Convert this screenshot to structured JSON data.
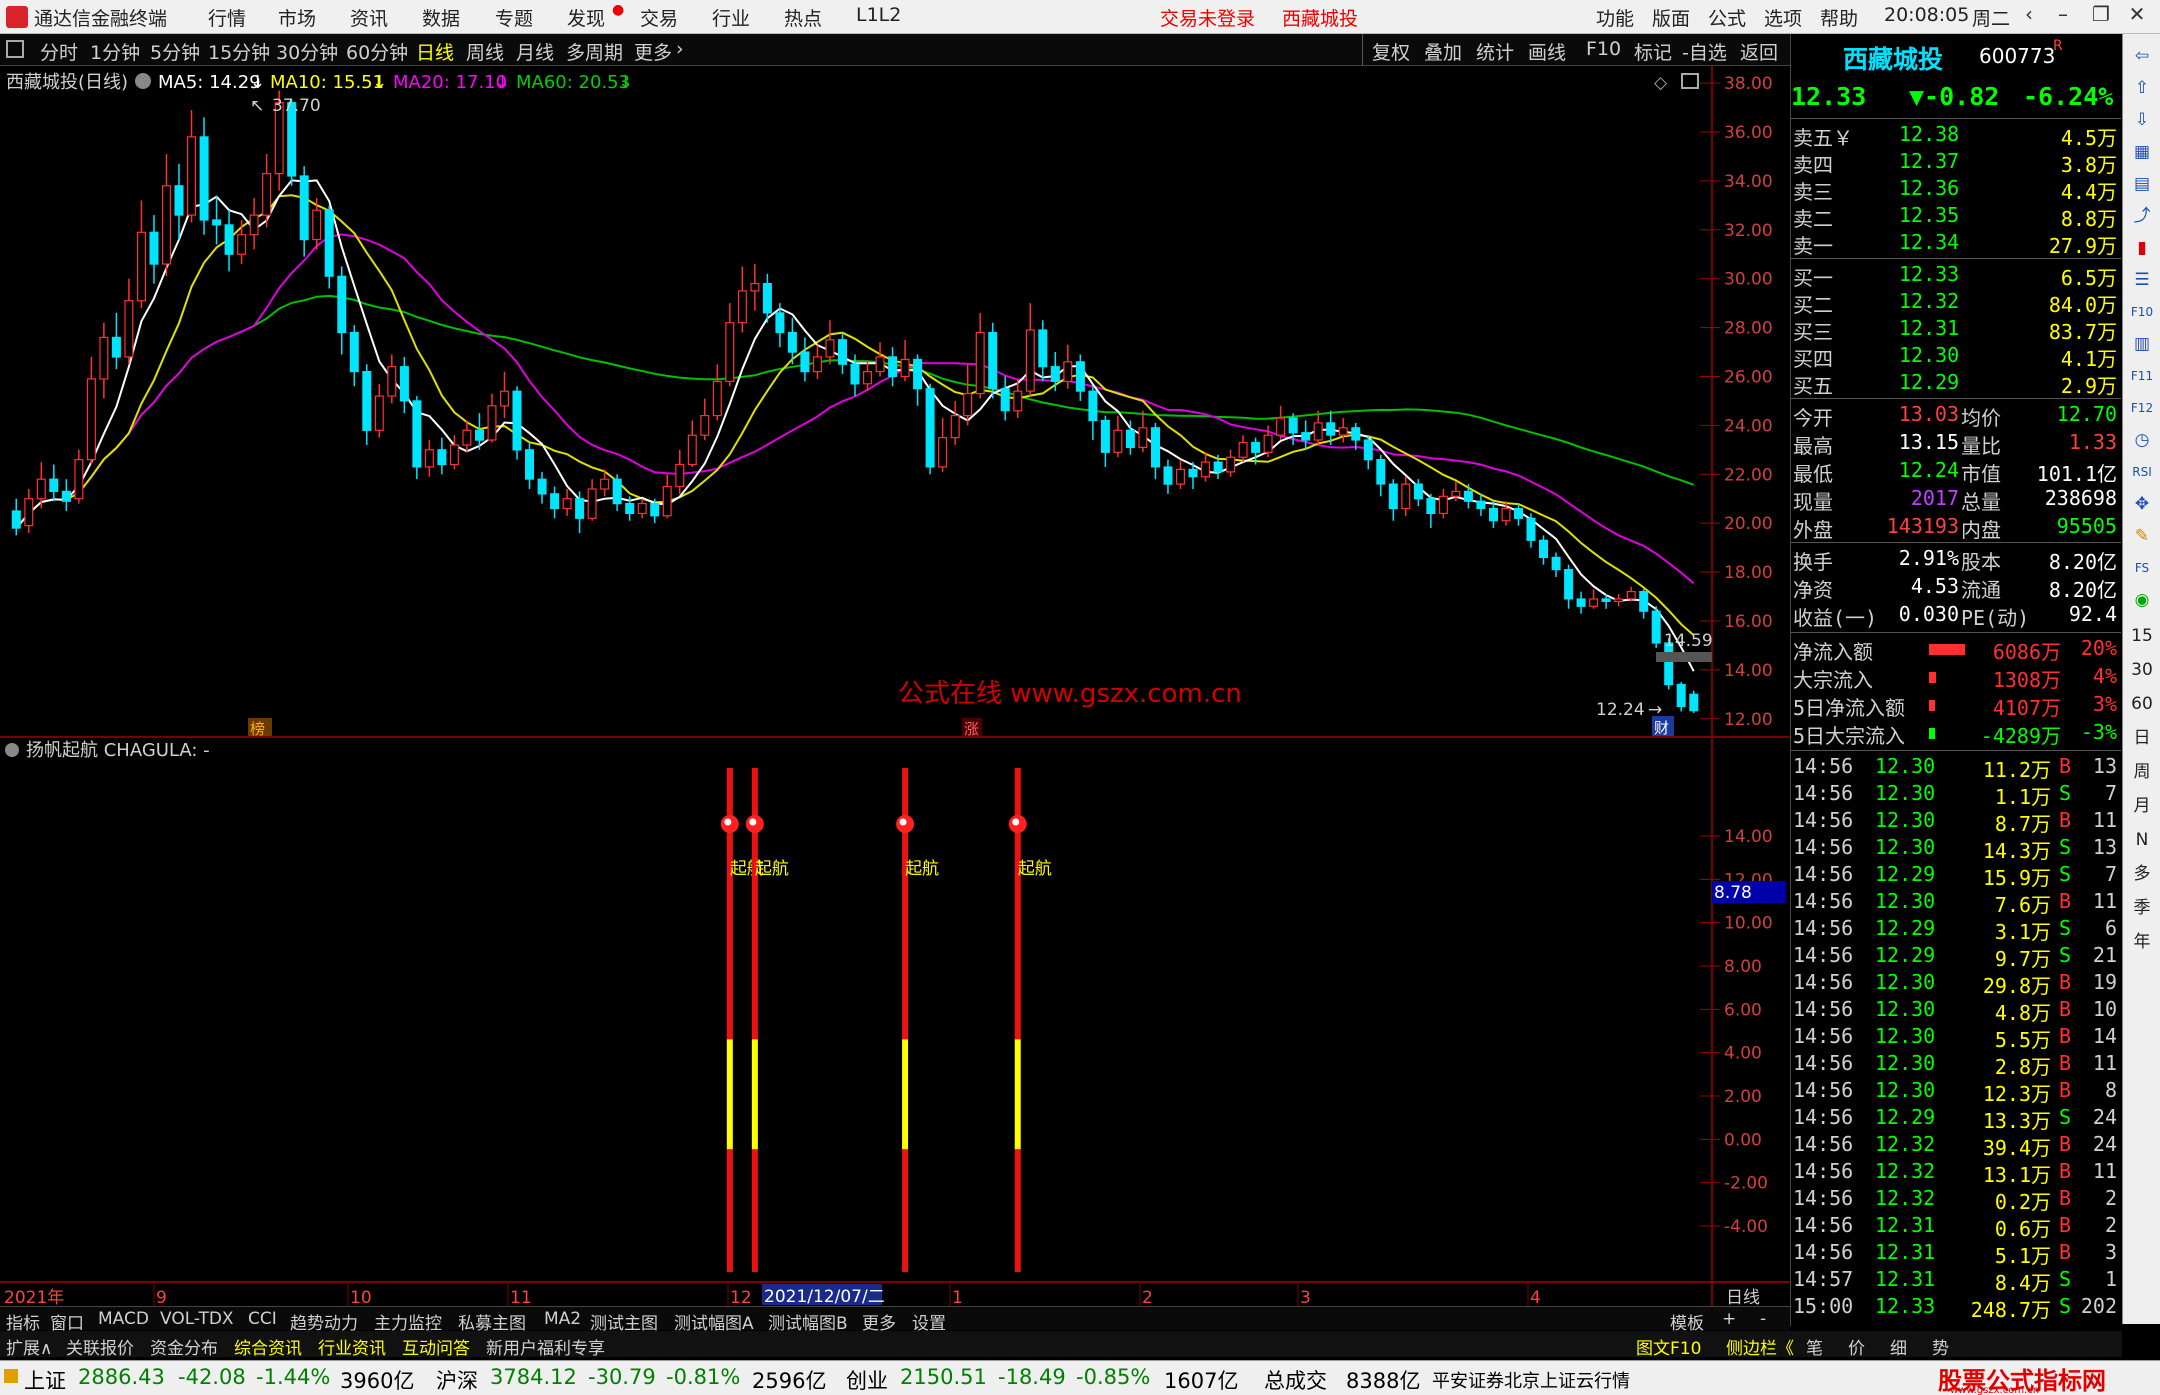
{
  "title_bar": {
    "app_title": "通达信金融终端",
    "menu": [
      "行情",
      "市场",
      "资讯",
      "数据",
      "专题",
      "发现",
      "交易",
      "行业",
      "热点",
      "L1L2"
    ],
    "trade_status": "交易未登录",
    "stock": "西藏城投",
    "right_menu": [
      "功能",
      "版面",
      "公式",
      "选项",
      "帮助"
    ],
    "time": "20:08:05",
    "weekday": "周二"
  },
  "period_bar": {
    "tabs": [
      "分时",
      "1分钟",
      "5分钟",
      "15分钟",
      "30分钟",
      "60分钟",
      "日线",
      "周线",
      "月线",
      "多周期",
      "更多"
    ],
    "active": "日线",
    "tools": [
      "复权",
      "叠加",
      "统计",
      "画线",
      "F10",
      "标记",
      "-自选",
      "返回"
    ]
  },
  "main_chart": {
    "header_stock": "西藏城投(日线)",
    "ma_labels": [
      {
        "text": "MA5: 14.29",
        "color": "#ffffff"
      },
      {
        "text": "MA10: 15.51",
        "color": "#ffff00"
      },
      {
        "text": "MA20: 17.10",
        "color": "#ff00ff"
      },
      {
        "text": "MA60: 20.53",
        "color": "#00d000"
      }
    ],
    "high_label": "37.70",
    "low_label": "12.24",
    "last_price_tag": "14.59",
    "watermark": "公式在线  www.gszx.com.cn",
    "event_marks": [
      "榜",
      "涨",
      "财"
    ],
    "y_ticks": [
      "38.00",
      "36.00",
      "34.00",
      "32.00",
      "30.00",
      "28.00",
      "26.00",
      "24.00",
      "22.00",
      "20.00",
      "18.00",
      "16.00",
      "14.00",
      "12.00"
    ]
  },
  "indicator_chart": {
    "header": "扬帆起航  CHAGULA: -",
    "signal_label": "起航",
    "value_tag": "8.78",
    "y_ticks": [
      "14.00",
      "12.00",
      "10.00",
      "8.00",
      "6.00",
      "4.00",
      "2.00",
      "0.00",
      "-2.00",
      "-4.00"
    ]
  },
  "date_axis": {
    "labels": [
      "2021年",
      "9",
      "10",
      "11",
      "12",
      "2021/12/07/二",
      "1",
      "2",
      "3",
      "4"
    ],
    "period": "日线"
  },
  "bottom_tabs": [
    "指标",
    "窗口",
    "MACD",
    "VOL-TDX",
    "CCI",
    "趋势动力",
    "主力监控",
    "私募主图",
    "MA2",
    "测试主图",
    "测试幅图A",
    "测试幅图B",
    "更多",
    "设置"
  ],
  "bottom_right": [
    "模板",
    "+",
    "-"
  ],
  "sub_tabs": [
    {
      "text": "扩展∧",
      "color": "#d0d0d0"
    },
    {
      "text": "关联报价",
      "color": "#d0d0d0"
    },
    {
      "text": "资金分布",
      "color": "#d0d0d0"
    },
    {
      "text": "综合资讯",
      "color": "#ffff00"
    },
    {
      "text": "行业资讯",
      "color": "#ffff00"
    },
    {
      "text": "互动问答",
      "color": "#ffff00"
    },
    {
      "text": "新用户福利专享",
      "color": "#d0d0d0"
    }
  ],
  "right_panel": {
    "name": "西藏城投",
    "code": "600773",
    "badge": "R",
    "price": "12.33",
    "change": "▼-0.82",
    "change_pct": "-6.24%",
    "asks": [
      {
        "label": "卖五￥",
        "price": "12.38",
        "vol": "4.5万"
      },
      {
        "label": "卖四",
        "price": "12.37",
        "vol": "3.8万"
      },
      {
        "label": "卖三",
        "price": "12.36",
        "vol": "4.4万"
      },
      {
        "label": "卖二",
        "price": "12.35",
        "vol": "8.8万"
      },
      {
        "label": "卖一",
        "price": "12.34",
        "vol": "27.9万"
      }
    ],
    "bids": [
      {
        "label": "买一",
        "price": "12.33",
        "vol": "6.5万"
      },
      {
        "label": "买二",
        "price": "12.32",
        "vol": "84.0万"
      },
      {
        "label": "买三",
        "price": "12.31",
        "vol": "83.7万"
      },
      {
        "label": "买四",
        "price": "12.30",
        "vol": "4.1万"
      },
      {
        "label": "买五",
        "price": "12.29",
        "vol": "2.9万"
      }
    ],
    "stats1": [
      [
        "今开",
        "13.03",
        "#ff4040",
        "均价",
        "12.70",
        "#00ff00"
      ],
      [
        "最高",
        "13.15",
        "#ffffff",
        "量比",
        "1.33",
        "#ff4040"
      ],
      [
        "最低",
        "12.24",
        "#00ff00",
        "市值",
        "101.1亿",
        "#ffffff"
      ],
      [
        "现量",
        "2017",
        "#c040ff",
        "总量",
        "238698",
        "#ffffff"
      ],
      [
        "外盘",
        "143193",
        "#ff4040",
        "内盘",
        "95505",
        "#00ff00"
      ]
    ],
    "stats2": [
      [
        "换手",
        "2.91%",
        "#ffffff",
        "股本",
        "8.20亿",
        "#ffffff"
      ],
      [
        "净资",
        "4.53",
        "#ffffff",
        "流通",
        "8.20亿",
        "#ffffff"
      ],
      [
        "收益(一)",
        "0.030",
        "#ffffff",
        "PE(动)",
        "92.4",
        "#ffffff"
      ]
    ],
    "flows": [
      {
        "label": "净流入额",
        "value": "6086万",
        "pct": "20%",
        "color": "#ff3030",
        "bar": 0.2
      },
      {
        "label": "大宗流入",
        "value": "1308万",
        "pct": "4%",
        "color": "#ff3030",
        "bar": 0.04
      },
      {
        "label": "5日净流入额",
        "value": "4107万",
        "pct": "3%",
        "color": "#ff3030",
        "bar": 0.03
      },
      {
        "label": "5日大宗流入",
        "value": "-4289万",
        "pct": "-3%",
        "color": "#00ff00",
        "bar": 0.03
      }
    ],
    "ticks": [
      [
        "14:56",
        "12.30",
        "11.2万",
        "B",
        "13"
      ],
      [
        "14:56",
        "12.30",
        "1.1万",
        "S",
        "7"
      ],
      [
        "14:56",
        "12.30",
        "8.7万",
        "B",
        "11"
      ],
      [
        "14:56",
        "12.30",
        "14.3万",
        "S",
        "13"
      ],
      [
        "14:56",
        "12.29",
        "15.9万",
        "S",
        "7"
      ],
      [
        "14:56",
        "12.30",
        "7.6万",
        "B",
        "11"
      ],
      [
        "14:56",
        "12.29",
        "3.1万",
        "S",
        "6"
      ],
      [
        "14:56",
        "12.29",
        "9.7万",
        "S",
        "21"
      ],
      [
        "14:56",
        "12.30",
        "29.8万",
        "B",
        "19"
      ],
      [
        "14:56",
        "12.30",
        "4.8万",
        "B",
        "10"
      ],
      [
        "14:56",
        "12.30",
        "5.5万",
        "B",
        "14"
      ],
      [
        "14:56",
        "12.30",
        "2.8万",
        "B",
        "11"
      ],
      [
        "14:56",
        "12.30",
        "12.3万",
        "B",
        "8"
      ],
      [
        "14:56",
        "12.29",
        "13.3万",
        "S",
        "24"
      ],
      [
        "14:56",
        "12.32",
        "39.4万",
        "B",
        "24"
      ],
      [
        "14:56",
        "12.32",
        "13.1万",
        "B",
        "11"
      ],
      [
        "14:56",
        "12.32",
        "0.2万",
        "B",
        "2"
      ],
      [
        "14:56",
        "12.31",
        "0.6万",
        "B",
        "2"
      ],
      [
        "14:56",
        "12.31",
        "5.1万",
        "B",
        "3"
      ],
      [
        "14:57",
        "12.31",
        "8.4万",
        "S",
        "1"
      ],
      [
        "15:00",
        "12.33",
        "248.7万",
        "S",
        "202"
      ]
    ],
    "bottom_tabs": [
      "图文F10",
      "侧边栏《",
      "笔",
      "价",
      "细",
      "势"
    ]
  },
  "toolstrip": {
    "icons": [
      "arrow-left-icon",
      "arrow-up-icon",
      "arrow-down-icon",
      "kline-icon",
      "grid-icon",
      "line-chart-icon",
      "candle-icon",
      "list-icon",
      "f10-icon",
      "f10b-icon",
      "f11-icon",
      "f12-icon",
      "clock-icon",
      "rsi-icon",
      "move-icon",
      "pen-icon",
      "fs-icon",
      "globe-icon"
    ],
    "labels": [
      "15",
      "30",
      "60",
      "日",
      "周",
      "月",
      "N",
      "多",
      "季",
      "年"
    ]
  },
  "status_bar": {
    "items": [
      {
        "name": "上证",
        "value": "2886.43",
        "change": "-42.08",
        "pct": "-1.44%",
        "amount": "3960亿"
      },
      {
        "name": "沪深",
        "value": "3784.12",
        "change": "-30.79",
        "pct": "-0.81%",
        "amount": "2596亿"
      },
      {
        "name": "创业",
        "value": "2150.51",
        "change": "-18.49",
        "pct": "-0.85%",
        "amount": "1607亿"
      }
    ],
    "total_label": "总成交",
    "total_value": "8388亿",
    "broker": "平安证券北京上证云行情",
    "site_logo": "股票公式指标网",
    "site_url": "www.gszx.com.cn"
  },
  "chart_data": {
    "type": "candlestick",
    "y_range": [
      11.5,
      38.7
    ],
    "candles": [
      [
        20.5,
        19.8,
        21.0,
        19.5
      ],
      [
        19.9,
        21.0,
        21.4,
        19.6
      ],
      [
        21.0,
        21.8,
        22.5,
        20.6
      ],
      [
        21.8,
        21.3,
        22.4,
        20.9
      ],
      [
        21.3,
        20.9,
        21.8,
        20.5
      ],
      [
        21.0,
        22.6,
        23.0,
        20.8
      ],
      [
        22.6,
        25.9,
        26.8,
        22.4
      ],
      [
        25.9,
        27.6,
        28.2,
        25.1
      ],
      [
        27.6,
        26.8,
        28.6,
        26.3
      ],
      [
        26.8,
        29.1,
        30.0,
        26.5
      ],
      [
        29.1,
        31.9,
        33.2,
        28.8
      ],
      [
        31.9,
        30.6,
        32.6,
        29.8
      ],
      [
        30.6,
        33.8,
        35.1,
        30.1
      ],
      [
        33.8,
        32.6,
        34.7,
        31.6
      ],
      [
        32.6,
        35.8,
        36.9,
        32.3
      ],
      [
        35.8,
        32.4,
        36.6,
        31.8
      ],
      [
        32.4,
        32.2,
        33.4,
        31.4
      ],
      [
        32.2,
        31.0,
        32.8,
        30.3
      ],
      [
        31.0,
        31.8,
        32.4,
        30.6
      ],
      [
        31.8,
        32.6,
        33.3,
        31.2
      ],
      [
        32.6,
        34.3,
        35.1,
        32.1
      ],
      [
        34.3,
        37.2,
        37.7,
        33.6
      ],
      [
        37.2,
        34.2,
        37.3,
        33.8
      ],
      [
        34.2,
        31.6,
        34.6,
        30.9
      ],
      [
        31.6,
        32.8,
        33.3,
        31.2
      ],
      [
        32.8,
        30.1,
        33.0,
        29.6
      ],
      [
        30.1,
        27.8,
        30.5,
        26.9
      ],
      [
        27.8,
        26.2,
        28.1,
        25.6
      ],
      [
        26.2,
        23.8,
        26.5,
        23.2
      ],
      [
        23.8,
        25.2,
        25.7,
        23.5
      ],
      [
        25.2,
        26.4,
        26.9,
        24.9
      ],
      [
        26.4,
        25.0,
        26.8,
        24.5
      ],
      [
        25.0,
        22.3,
        25.2,
        21.8
      ],
      [
        22.3,
        23.0,
        23.4,
        21.9
      ],
      [
        23.0,
        22.4,
        23.5,
        22.0
      ],
      [
        22.4,
        23.2,
        23.6,
        22.2
      ],
      [
        23.2,
        23.8,
        24.2,
        22.9
      ],
      [
        23.8,
        23.4,
        24.5,
        23.0
      ],
      [
        23.4,
        24.8,
        25.3,
        23.3
      ],
      [
        24.8,
        25.4,
        26.2,
        24.3
      ],
      [
        25.4,
        23.0,
        25.6,
        22.6
      ],
      [
        23.0,
        21.8,
        23.3,
        21.4
      ],
      [
        21.8,
        21.2,
        22.1,
        20.8
      ],
      [
        21.2,
        20.6,
        21.5,
        20.2
      ],
      [
        20.6,
        21.0,
        21.4,
        20.3
      ],
      [
        21.0,
        20.2,
        21.3,
        19.6
      ],
      [
        20.2,
        21.4,
        21.8,
        20.1
      ],
      [
        21.4,
        21.8,
        22.2,
        21.1
      ],
      [
        21.8,
        20.8,
        22.0,
        20.5
      ],
      [
        20.8,
        20.4,
        21.1,
        20.1
      ],
      [
        20.4,
        20.8,
        21.0,
        20.2
      ],
      [
        20.8,
        20.3,
        21.0,
        20.0
      ],
      [
        20.3,
        21.5,
        22.0,
        20.2
      ],
      [
        21.5,
        22.4,
        23.0,
        21.2
      ],
      [
        22.4,
        23.6,
        24.2,
        22.3
      ],
      [
        23.6,
        24.4,
        25.1,
        23.4
      ],
      [
        24.4,
        25.8,
        26.5,
        24.2
      ],
      [
        25.8,
        28.2,
        29.0,
        25.6
      ],
      [
        28.2,
        29.5,
        30.5,
        27.8
      ],
      [
        29.5,
        29.8,
        30.6,
        28.7
      ],
      [
        29.8,
        28.6,
        30.2,
        28.2
      ],
      [
        28.6,
        27.8,
        29.0,
        27.2
      ],
      [
        27.8,
        27.0,
        28.4,
        26.5
      ],
      [
        27.0,
        26.2,
        27.6,
        25.8
      ],
      [
        26.2,
        26.8,
        27.3,
        25.9
      ],
      [
        26.8,
        27.5,
        28.3,
        26.5
      ],
      [
        27.5,
        26.5,
        27.8,
        26.1
      ],
      [
        26.5,
        25.7,
        26.9,
        25.2
      ],
      [
        25.7,
        26.2,
        26.6,
        25.4
      ],
      [
        26.2,
        26.8,
        27.4,
        26.0
      ],
      [
        26.8,
        26.0,
        27.2,
        25.6
      ],
      [
        26.0,
        26.7,
        27.5,
        25.8
      ],
      [
        26.7,
        25.5,
        26.9,
        24.8
      ],
      [
        25.5,
        22.3,
        25.7,
        22.0
      ],
      [
        22.3,
        23.5,
        24.3,
        22.1
      ],
      [
        23.5,
        24.4,
        25.0,
        23.2
      ],
      [
        24.4,
        25.3,
        26.5,
        24.0
      ],
      [
        25.3,
        27.8,
        28.6,
        25.1
      ],
      [
        27.8,
        25.5,
        28.2,
        25.1
      ],
      [
        25.5,
        24.6,
        26.0,
        24.2
      ],
      [
        24.6,
        25.4,
        25.9,
        24.3
      ],
      [
        25.4,
        27.9,
        29.0,
        25.2
      ],
      [
        27.9,
        26.4,
        28.3,
        25.8
      ],
      [
        26.4,
        25.8,
        27.0,
        25.4
      ],
      [
        25.8,
        26.6,
        27.3,
        25.5
      ],
      [
        26.6,
        25.4,
        26.9,
        25.0
      ],
      [
        25.4,
        24.2,
        25.6,
        23.4
      ],
      [
        24.2,
        22.9,
        24.4,
        22.3
      ],
      [
        22.9,
        23.8,
        24.4,
        22.7
      ],
      [
        23.8,
        23.1,
        24.2,
        22.8
      ],
      [
        23.1,
        23.9,
        24.6,
        22.9
      ],
      [
        23.9,
        22.3,
        24.1,
        21.8
      ],
      [
        22.3,
        21.6,
        22.6,
        21.2
      ],
      [
        21.6,
        22.2,
        22.6,
        21.4
      ],
      [
        22.2,
        21.9,
        22.5,
        21.4
      ],
      [
        21.9,
        22.5,
        22.9,
        21.7
      ],
      [
        22.5,
        22.1,
        22.8,
        21.8
      ],
      [
        22.1,
        22.7,
        23.0,
        21.9
      ],
      [
        22.7,
        23.3,
        23.6,
        22.5
      ],
      [
        23.3,
        22.9,
        23.5,
        22.4
      ],
      [
        22.9,
        23.6,
        24.0,
        22.7
      ],
      [
        23.6,
        24.3,
        24.8,
        23.4
      ],
      [
        24.3,
        23.7,
        24.5,
        23.2
      ],
      [
        23.7,
        23.4,
        24.2,
        23.0
      ],
      [
        23.4,
        24.1,
        24.6,
        23.2
      ],
      [
        24.1,
        23.6,
        24.6,
        23.2
      ],
      [
        23.6,
        23.9,
        24.3,
        23.3
      ],
      [
        23.9,
        23.4,
        24.1,
        23.0
      ],
      [
        23.4,
        22.6,
        23.6,
        22.2
      ],
      [
        22.6,
        21.6,
        22.8,
        21.1
      ],
      [
        21.6,
        20.6,
        21.8,
        20.1
      ],
      [
        20.6,
        21.6,
        21.9,
        20.3
      ],
      [
        21.6,
        21.0,
        21.8,
        20.7
      ],
      [
        21.0,
        20.4,
        21.2,
        19.8
      ],
      [
        20.4,
        21.1,
        21.4,
        20.2
      ],
      [
        21.1,
        21.3,
        21.7,
        20.9
      ],
      [
        21.3,
        20.9,
        21.6,
        20.6
      ],
      [
        20.9,
        20.6,
        21.2,
        20.3
      ],
      [
        20.6,
        20.1,
        20.9,
        19.8
      ],
      [
        20.1,
        20.6,
        20.9,
        19.9
      ],
      [
        20.6,
        20.2,
        20.8,
        19.9
      ],
      [
        20.2,
        19.3,
        20.4,
        19.0
      ],
      [
        19.3,
        18.6,
        19.5,
        18.3
      ],
      [
        18.6,
        18.1,
        18.8,
        17.8
      ],
      [
        18.1,
        16.9,
        18.3,
        16.5
      ],
      [
        16.9,
        16.6,
        17.2,
        16.3
      ],
      [
        16.6,
        16.9,
        17.3,
        16.5
      ],
      [
        16.9,
        16.8,
        17.1,
        16.5
      ],
      [
        16.8,
        16.9,
        17.1,
        16.6
      ],
      [
        16.9,
        17.2,
        17.4,
        16.8
      ],
      [
        17.2,
        16.4,
        17.3,
        16.1
      ],
      [
        16.4,
        15.1,
        16.6,
        14.9
      ],
      [
        15.1,
        13.4,
        15.3,
        13.2
      ],
      [
        13.4,
        12.5,
        13.5,
        12.3
      ],
      [
        13.0,
        12.33,
        13.15,
        12.24
      ]
    ],
    "signals": [
      {
        "index": 57,
        "value": 6.0,
        "label": "起航"
      },
      {
        "index": 59,
        "value": 6.0,
        "label": "起航"
      },
      {
        "index": 71,
        "value": 6.0,
        "label": "起航"
      },
      {
        "index": 80,
        "value": 6.0,
        "label": "起航"
      },
      {
        "index": 149,
        "value": 6.0,
        "label": "起航"
      },
      {
        "index": 155,
        "value": 6.0,
        "label": "起航"
      },
      {
        "index": 156,
        "value": 6.0,
        "label": "起航"
      },
      {
        "index": 159,
        "value": 6.0,
        "label": "起航"
      },
      {
        "index": 162,
        "value": 6.0,
        "label": "起航"
      },
      {
        "index": 164,
        "value": 6.0,
        "label": "起航"
      },
      {
        "index": 165,
        "value": 6.0,
        "label": "起航"
      }
    ],
    "indicator_range": [
      -4,
      14
    ]
  }
}
